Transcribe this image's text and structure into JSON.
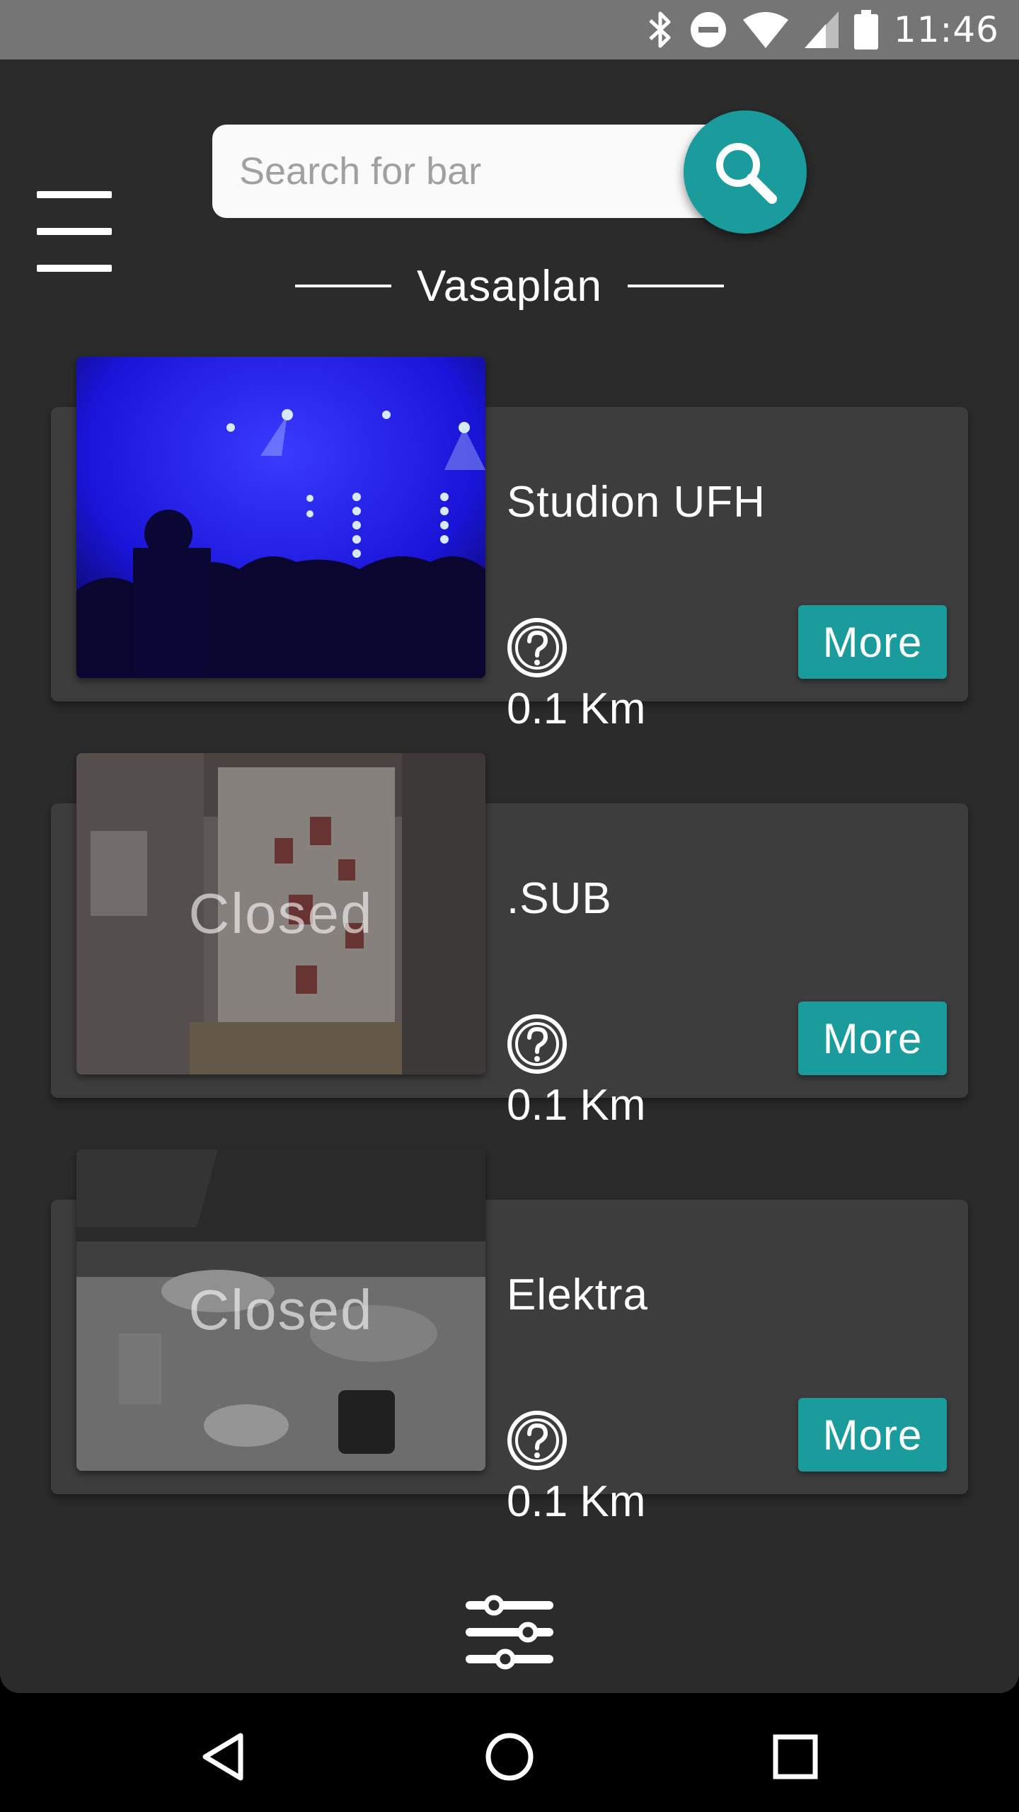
{
  "status_bar": {
    "time": "11:46",
    "icons": [
      "bluetooth-icon",
      "do-not-disturb-icon",
      "wifi-icon",
      "signal-icon",
      "battery-icon"
    ]
  },
  "header": {
    "menu_icon": "hamburger-menu-icon",
    "search_placeholder": "Search for bar",
    "search_value": "",
    "search_icon": "search-icon",
    "location": "Vasaplan"
  },
  "bars": [
    {
      "name": "Studion UFH",
      "distance": "0.1 Km",
      "status": "",
      "more_label": "More",
      "image": "concert-blue-stage"
    },
    {
      "name": ".SUB",
      "distance": "0.1 Km",
      "status": "Closed",
      "more_label": "More",
      "image": "bar-door-posters"
    },
    {
      "name": "Elektra",
      "distance": "0.1 Km",
      "status": "Closed",
      "more_label": "More",
      "image": "restaurant-table"
    }
  ],
  "bottom": {
    "filter_icon": "sliders-filter-icon"
  },
  "nav": {
    "back_icon": "back-triangle-icon",
    "home_icon": "home-circle-icon",
    "recents_icon": "recents-square-icon"
  },
  "colors": {
    "accent": "#1a9c9c",
    "background": "#2b2b2b",
    "card": "#3d3d3d",
    "status_bar": "#757575"
  }
}
